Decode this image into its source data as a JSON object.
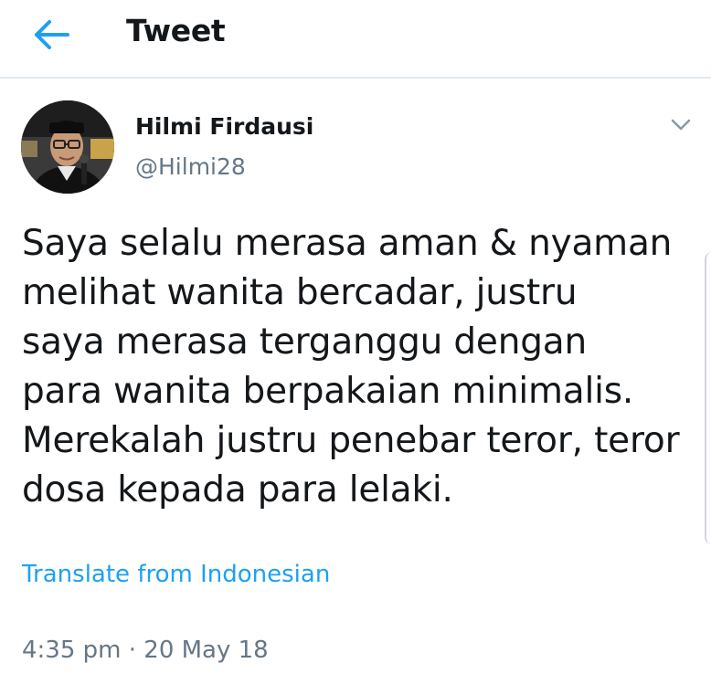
{
  "header": {
    "title": "Tweet",
    "back_icon": "arrow-left-icon"
  },
  "author": {
    "name": "Hilmi Firdausi",
    "handle": "@Hilmi28"
  },
  "tweet": {
    "lines": [
      "Saya selalu merasa aman & nyaman",
      "melihat wanita bercadar, justru",
      "saya merasa terganggu dengan",
      "para wanita berpakaian minimalis.",
      "Merekalah justru penebar teror, teror",
      "dosa kepada para lelaki."
    ],
    "translate_label": "Translate from Indonesian",
    "timestamp": "4:35 pm · 20 May 18"
  },
  "colors": {
    "accent": "#1da1f2",
    "secondary_text": "#657786",
    "divider": "#e1e8ed"
  }
}
